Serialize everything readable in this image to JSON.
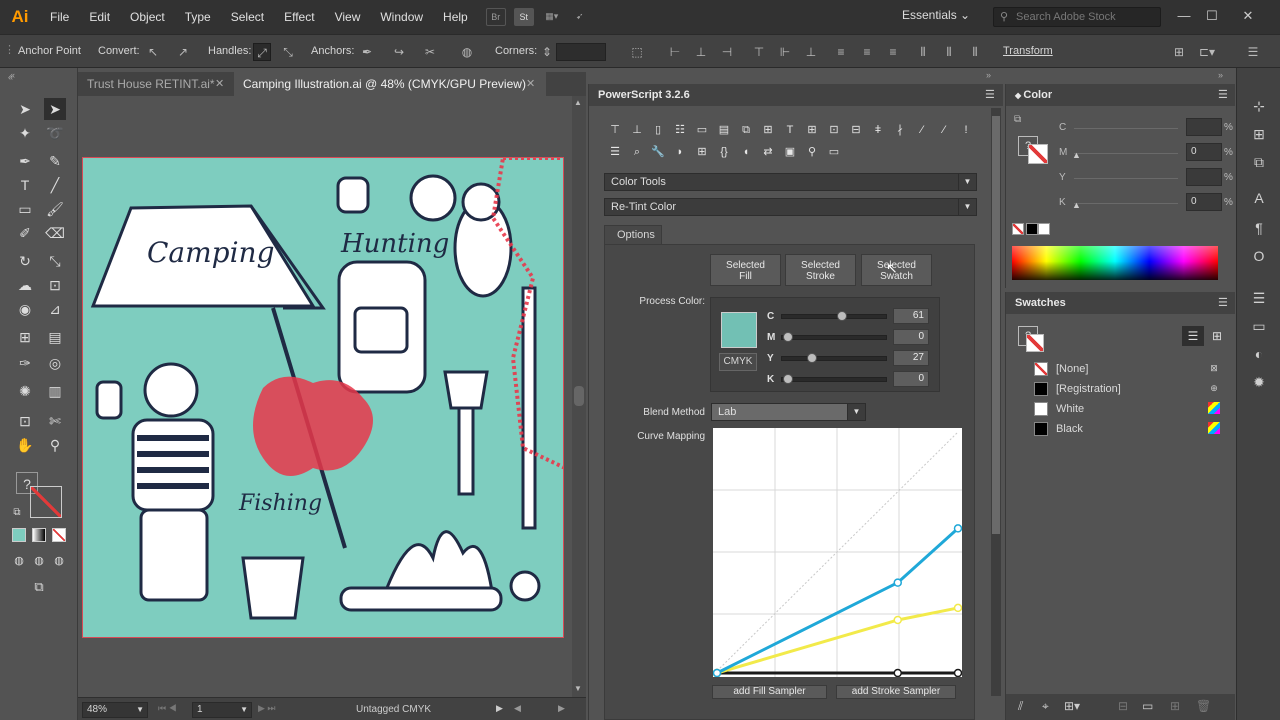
{
  "app": {
    "logo": "Ai"
  },
  "menu": [
    "File",
    "Edit",
    "Object",
    "Type",
    "Select",
    "Effect",
    "View",
    "Window",
    "Help"
  ],
  "menubar_extras": {
    "br": "Br",
    "st": "St"
  },
  "workspace": "Essentials",
  "search": {
    "placeholder": "Search Adobe Stock"
  },
  "control_bar": {
    "anchor_point": "Anchor Point",
    "convert": "Convert:",
    "handles": "Handles:",
    "anchors": "Anchors:",
    "corners": "Corners:",
    "transform": "Transform"
  },
  "tabs": [
    {
      "label": "Trust House RETINT.ai*",
      "active": false
    },
    {
      "label": "Camping Illustration.ai @ 48% (CMYK/GPU Preview)",
      "active": true
    }
  ],
  "artwork": {
    "camping": "Camping",
    "hunting": "Hunting",
    "fishing": "Fishing"
  },
  "status": {
    "zoom": "48%",
    "page": "1",
    "profile": "Untagged CMYK"
  },
  "powerscript": {
    "title": "PowerScript 3.2.6",
    "category": "Color Tools",
    "tool": "Re-Tint Color",
    "options_tab": "Options",
    "buttons": [
      {
        "line1": "Selected",
        "line2": "Fill"
      },
      {
        "line1": "Selected",
        "line2": "Stroke"
      },
      {
        "line1": "Selected",
        "line2": "Swatch"
      }
    ],
    "process_color_label": "Process Color:",
    "cmyk_button": "CMYK",
    "channels": [
      {
        "name": "C",
        "value": 61
      },
      {
        "name": "M",
        "value": 0
      },
      {
        "name": "Y",
        "value": 27
      },
      {
        "name": "K",
        "value": 0
      }
    ],
    "blend_label": "Blend Method",
    "blend_value": "Lab",
    "curve_label": "Curve Mapping",
    "curve": {
      "blue": [
        [
          0,
          0
        ],
        [
          0.75,
          0.375
        ],
        [
          1,
          0.6
        ]
      ],
      "yellow": [
        [
          0,
          0
        ],
        [
          0.75,
          0.22
        ],
        [
          1,
          0.27
        ]
      ],
      "black": [
        [
          0,
          0
        ],
        [
          0.75,
          0
        ],
        [
          1,
          0
        ]
      ]
    },
    "bottom_buttons": [
      "add Fill Sampler",
      "add Stroke Sampler"
    ]
  },
  "color_panel": {
    "title": "Color",
    "channels": [
      {
        "name": "C",
        "value": ""
      },
      {
        "name": "M",
        "value": "0"
      },
      {
        "name": "Y",
        "value": ""
      },
      {
        "name": "K",
        "value": "0"
      }
    ],
    "pct": "%"
  },
  "swatches_panel": {
    "title": "Swatches",
    "items": [
      {
        "name": "[None]",
        "color": "none"
      },
      {
        "name": "[Registration]",
        "color": "#000000"
      },
      {
        "name": "White",
        "color": "#ffffff"
      },
      {
        "name": "Black",
        "color": "#000000"
      }
    ]
  },
  "colors": {
    "artboard": "#7ecdbf",
    "ink": "#1f2a44",
    "selection": "#e8374a",
    "curve_blue": "#1fa8d8",
    "curve_yellow": "#f2ea4a"
  }
}
